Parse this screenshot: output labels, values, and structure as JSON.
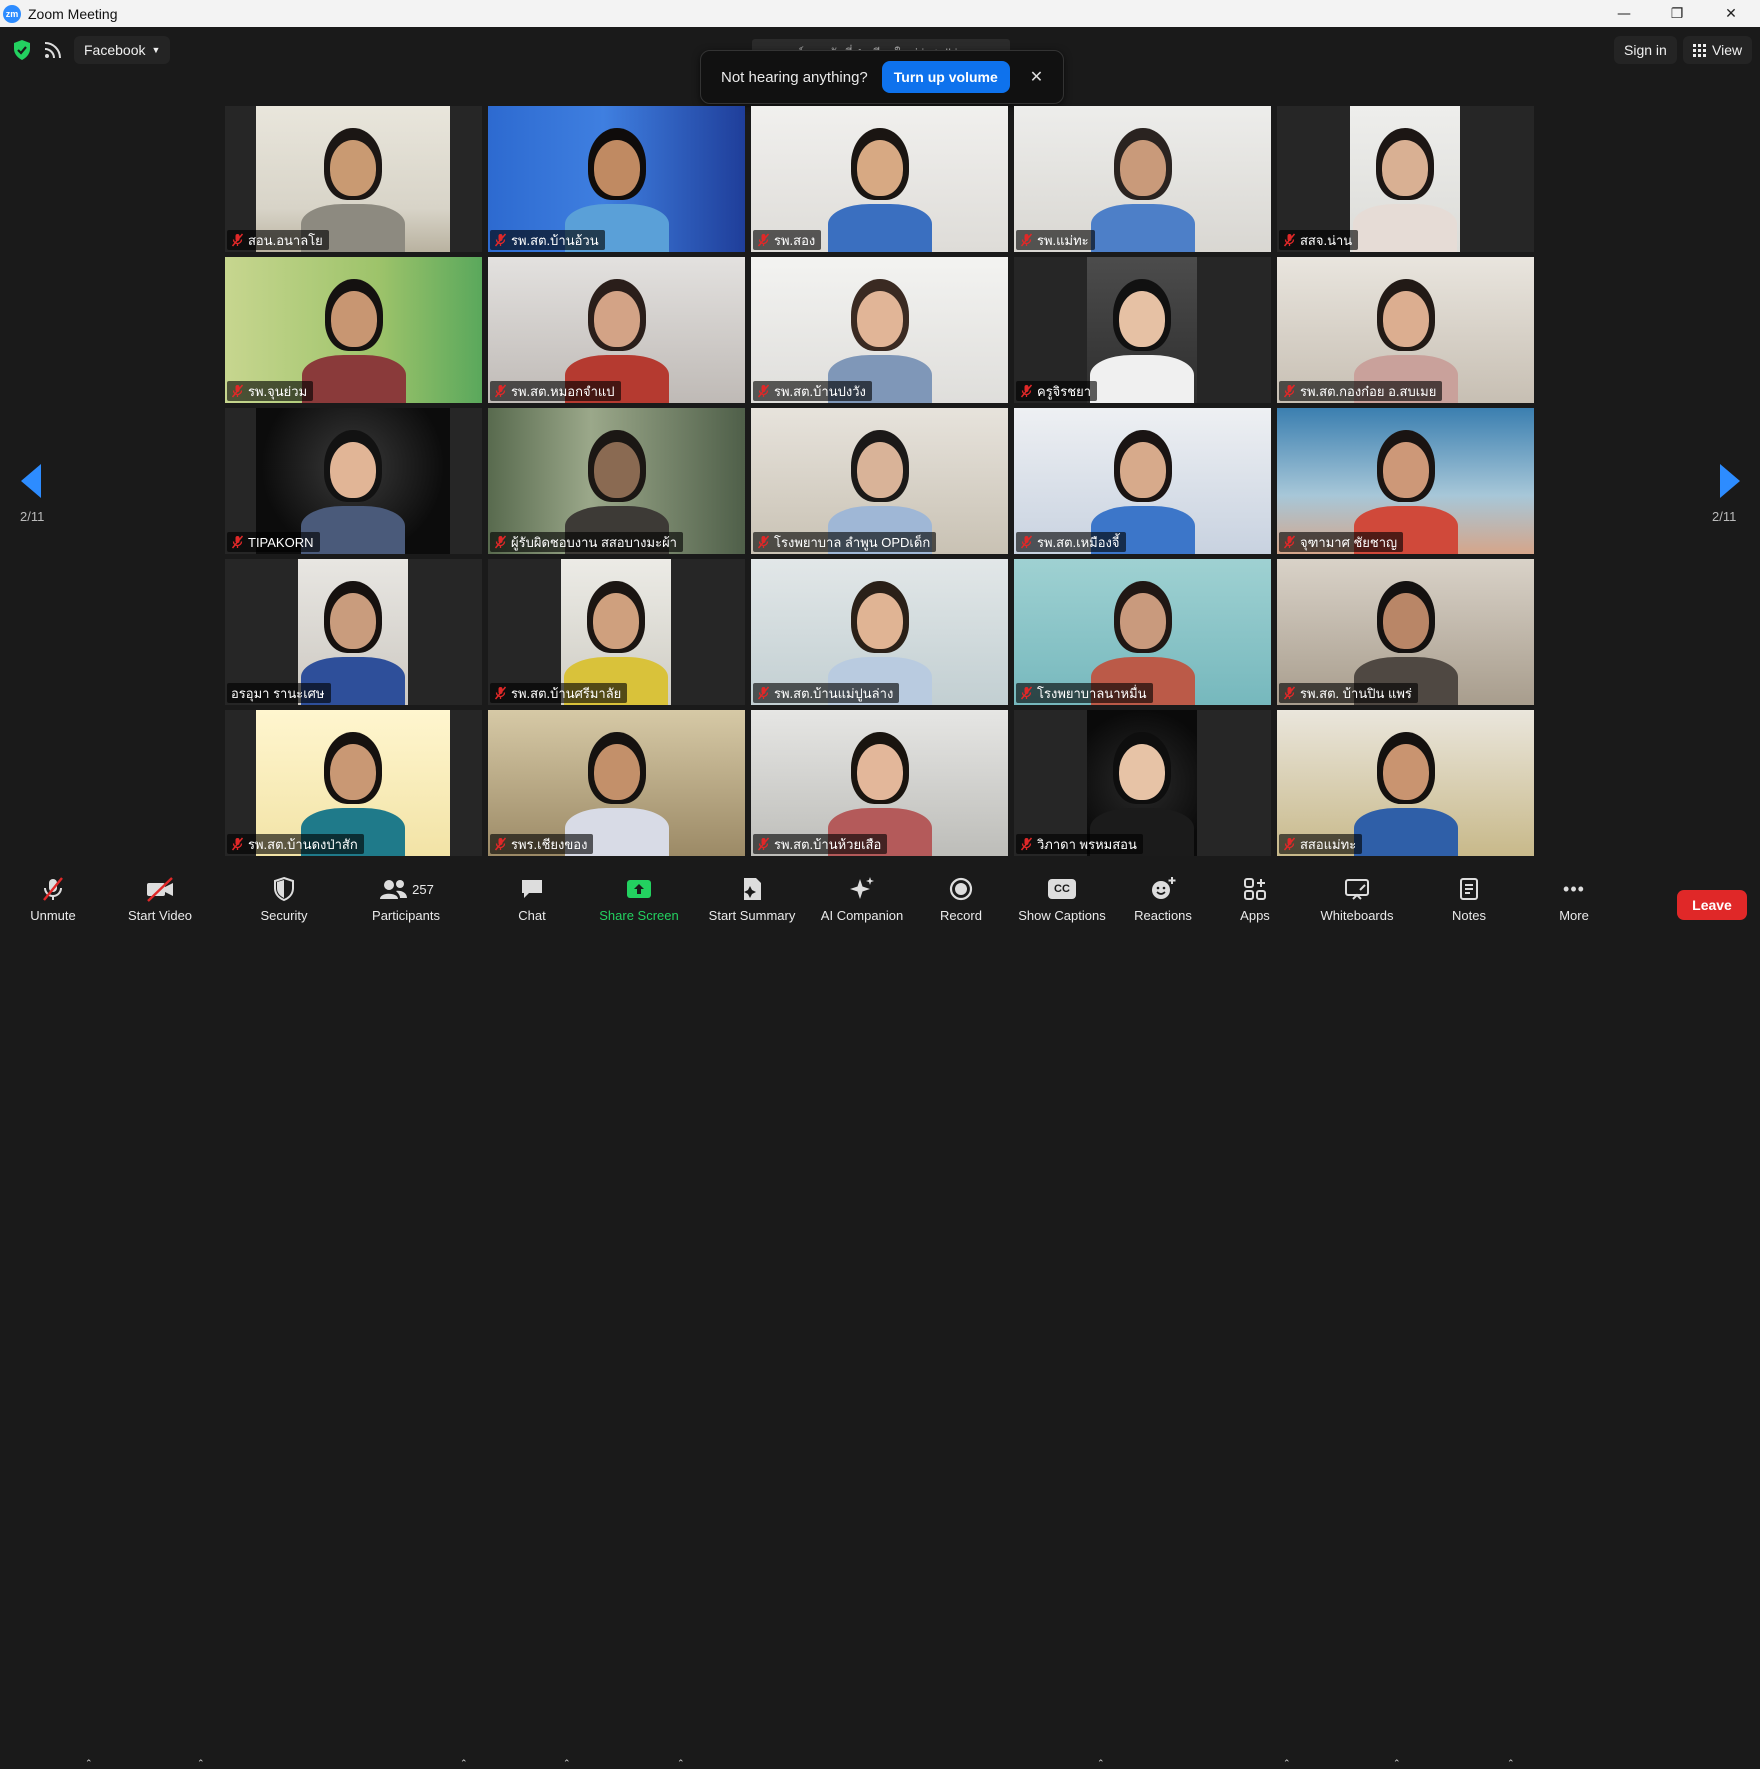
{
  "window": {
    "title": "Zoom Meeting",
    "logo_text": "zm",
    "minimize": "—",
    "restore": "❐",
    "close": "✕"
  },
  "topbar": {
    "stream_label": "Facebook",
    "speaker_status": "ศูนย์อนามัยที่ 1 เชียงใหม่ is  talking...",
    "sign_in": "Sign in",
    "view": "View"
  },
  "banner": {
    "message": "Not hearing anything?",
    "button": "Turn up volume",
    "close": "✕"
  },
  "pagination": {
    "left": "2/11",
    "right": "2/11"
  },
  "colors": {
    "accent": "#2d8cff",
    "muted_red": "#e02828",
    "share_green": "#23d160",
    "shield_green": "#23d160"
  },
  "participants": [
    {
      "name": "สอน.อนาลโย",
      "muted": true
    },
    {
      "name": "รพ.สต.บ้านอ้วน",
      "muted": true
    },
    {
      "name": "รพ.สอง",
      "muted": true
    },
    {
      "name": "รพ.แม่ทะ",
      "muted": true
    },
    {
      "name": "สสจ.น่าน",
      "muted": true
    },
    {
      "name": "รพ.จุนย่วม",
      "muted": true
    },
    {
      "name": "รพ.สต.หมอกจำแป",
      "muted": true
    },
    {
      "name": "รพ.สต.บ้านปงวัง",
      "muted": true
    },
    {
      "name": "ครูจิรชยา",
      "muted": true
    },
    {
      "name": "รพ.สต.กองก๋อย อ.สบเมย",
      "muted": true
    },
    {
      "name": "TIPAKORN",
      "muted": true
    },
    {
      "name": "ผู้รับผิดชอบงาน สสอบางมะผ้า",
      "muted": true
    },
    {
      "name": "โรงพยาบาล ลำพูน OPDเด็ก",
      "muted": true
    },
    {
      "name": "รพ.สต.เหมืองจี้",
      "muted": true
    },
    {
      "name": "จุฑามาศ  ชัยชาญ",
      "muted": true
    },
    {
      "name": "อรอุมา รานะเศษ",
      "muted": false
    },
    {
      "name": "รพ.สต.บ้านศรีมาลัย",
      "muted": true
    },
    {
      "name": "รพ.สต.บ้านแม่ปูนล่าง",
      "muted": true
    },
    {
      "name": "โรงพยาบาลนาหมื่น",
      "muted": true
    },
    {
      "name": "รพ.สต. บ้านปิน แพร่",
      "muted": true
    },
    {
      "name": "รพ.สต.บ้านดงป่าสัก",
      "muted": true
    },
    {
      "name": "รพร.เชียงของ",
      "muted": true
    },
    {
      "name": "รพ.สต.บ้านห้วยเสือ",
      "muted": true
    },
    {
      "name": "วิภาดา พรหมสอน",
      "muted": true
    },
    {
      "name": "สสอแม่ทะ",
      "muted": true
    }
  ],
  "toolbar": {
    "unmute": "Unmute",
    "start_video": "Start Video",
    "security": "Security",
    "participants": "Participants",
    "participants_count": "257",
    "chat": "Chat",
    "share_screen": "Share Screen",
    "start_summary": "Start Summary",
    "ai_companion": "AI Companion",
    "record": "Record",
    "show_captions": "Show Captions",
    "captions_icon_text": "CC",
    "reactions": "Reactions",
    "apps": "Apps",
    "whiteboards": "Whiteboards",
    "notes": "Notes",
    "more": "More",
    "more_icon": "•••",
    "leave": "Leave"
  }
}
